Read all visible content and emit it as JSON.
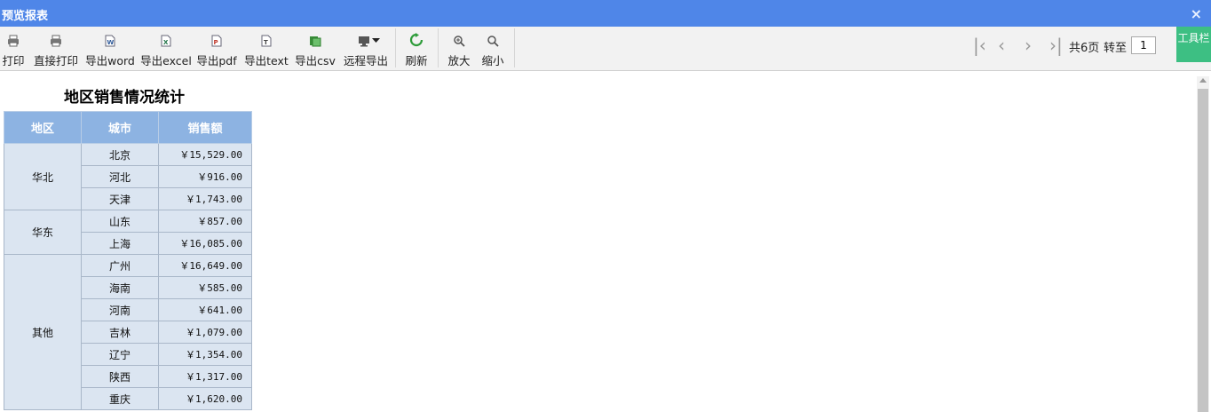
{
  "window": {
    "title": "预览报表",
    "close_glyph": "×"
  },
  "toolbar": {
    "items": [
      {
        "label": "打印",
        "icon": "printer-icon"
      },
      {
        "label": "直接打印",
        "icon": "printer-icon"
      },
      {
        "label": "导出word",
        "icon": "word-icon"
      },
      {
        "label": "导出excel",
        "icon": "excel-icon"
      },
      {
        "label": "导出pdf",
        "icon": "pdf-icon"
      },
      {
        "label": "导出text",
        "icon": "text-icon"
      },
      {
        "label": "导出csv",
        "icon": "csv-icon"
      },
      {
        "label": "远程导出",
        "icon": "monitor-icon"
      },
      {
        "label": "刷新",
        "icon": "refresh-icon"
      },
      {
        "label": "放大",
        "icon": "zoom-in-icon"
      },
      {
        "label": "缩小",
        "icon": "zoom-out-icon"
      }
    ],
    "toggle_label": "工具栏"
  },
  "pager": {
    "total_text": "共6页",
    "goto_label": "转至",
    "page_value": "1"
  },
  "colors": {
    "titlebar": "#4f86e8",
    "header": "#8db3e2",
    "cell": "#dbe5f1",
    "toolbar_btn": "#3dbf83",
    "refresh": "#2e9c3a"
  },
  "report": {
    "title": "地区销售情况统计",
    "headers": [
      "地区",
      "城市",
      "销售额"
    ],
    "groups": [
      {
        "region": "华北",
        "rows": [
          {
            "city": "北京",
            "amount": "￥15,529.00"
          },
          {
            "city": "河北",
            "amount": "￥916.00"
          },
          {
            "city": "天津",
            "amount": "￥1,743.00"
          }
        ]
      },
      {
        "region": "华东",
        "rows": [
          {
            "city": "山东",
            "amount": "￥857.00"
          },
          {
            "city": "上海",
            "amount": "￥16,085.00"
          }
        ]
      },
      {
        "region": "其他",
        "rows": [
          {
            "city": "广州",
            "amount": "￥16,649.00"
          },
          {
            "city": "海南",
            "amount": "￥585.00"
          },
          {
            "city": "河南",
            "amount": "￥641.00"
          },
          {
            "city": "吉林",
            "amount": "￥1,079.00"
          },
          {
            "city": "辽宁",
            "amount": "￥1,354.00"
          },
          {
            "city": "陕西",
            "amount": "￥1,317.00"
          },
          {
            "city": "重庆",
            "amount": "￥1,620.00"
          }
        ]
      }
    ]
  }
}
